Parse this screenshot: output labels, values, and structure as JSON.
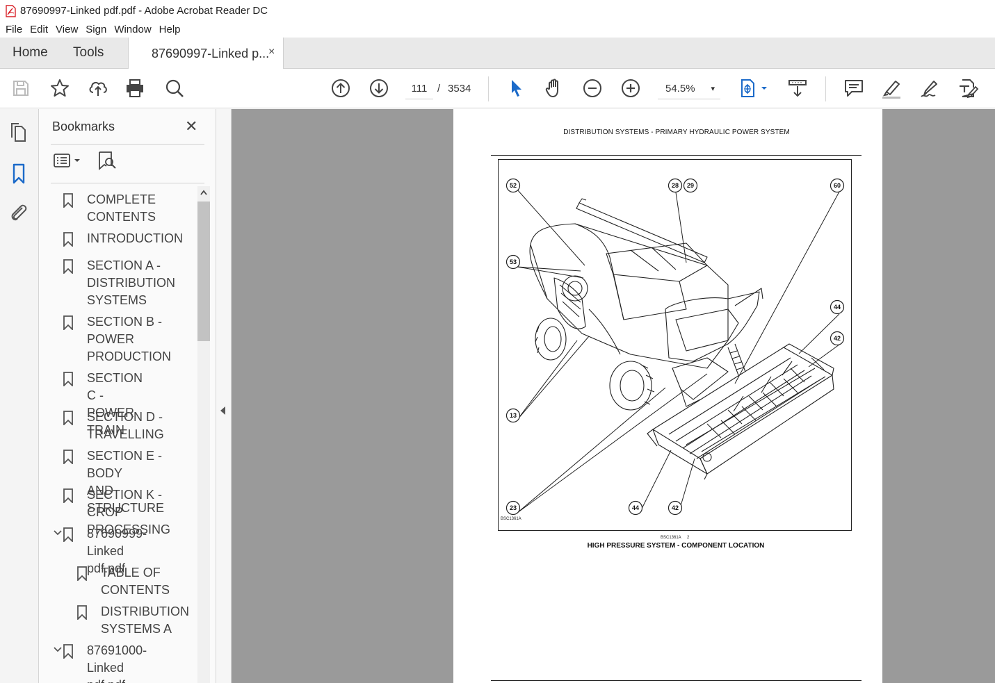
{
  "window": {
    "title": "87690997-Linked pdf.pdf - Adobe Acrobat Reader DC"
  },
  "menu": [
    "File",
    "Edit",
    "View",
    "Sign",
    "Window",
    "Help"
  ],
  "tabs": {
    "home": "Home",
    "tools": "Tools",
    "document": "87690997-Linked p...",
    "close": "×"
  },
  "toolbar": {
    "page_current": "111",
    "page_sep": "/",
    "page_total": "3534",
    "zoom": "54.5%",
    "zoom_caret": "▾"
  },
  "bookmarks": {
    "title": "Bookmarks",
    "close": "✕",
    "items": [
      {
        "label": "COMPLETE\nCONTENTS"
      },
      {
        "label": "INTRODUCTION"
      },
      {
        "label": "SECTION A -\nDISTRIBUTION\nSYSTEMS"
      },
      {
        "label": "SECTION B -\nPOWER\nPRODUCTION"
      },
      {
        "label": "SECTION C -\nPOWER TRAIN"
      },
      {
        "label": "SECTION D -\nTRAVELLING"
      },
      {
        "label": "SECTION E - BODY\nAND STRUCTURE"
      },
      {
        "label": "SECTION K - CROP\nPROCESSING"
      },
      {
        "label": "87690999-Linked\npdf.pdf"
      },
      {
        "label": "TABLE OF\nCONTENTS"
      },
      {
        "label": "DISTRIBUTION\nSYSTEMS A"
      },
      {
        "label": "87691000-Linked\npdf.pdf"
      }
    ]
  },
  "document_page": {
    "header": "DISTRIBUTION SYSTEMS - PRIMARY HYDRAULIC POWER SYSTEM",
    "figure_code": "BSC1361A",
    "figure_code_small": "BSC1361A",
    "figure_number": "2",
    "caption": "HIGH PRESSURE SYSTEM - COMPONENT LOCATION",
    "callouts": [
      "52",
      "28",
      "29",
      "60",
      "53",
      "44",
      "42",
      "13",
      "23",
      "44",
      "42"
    ]
  }
}
